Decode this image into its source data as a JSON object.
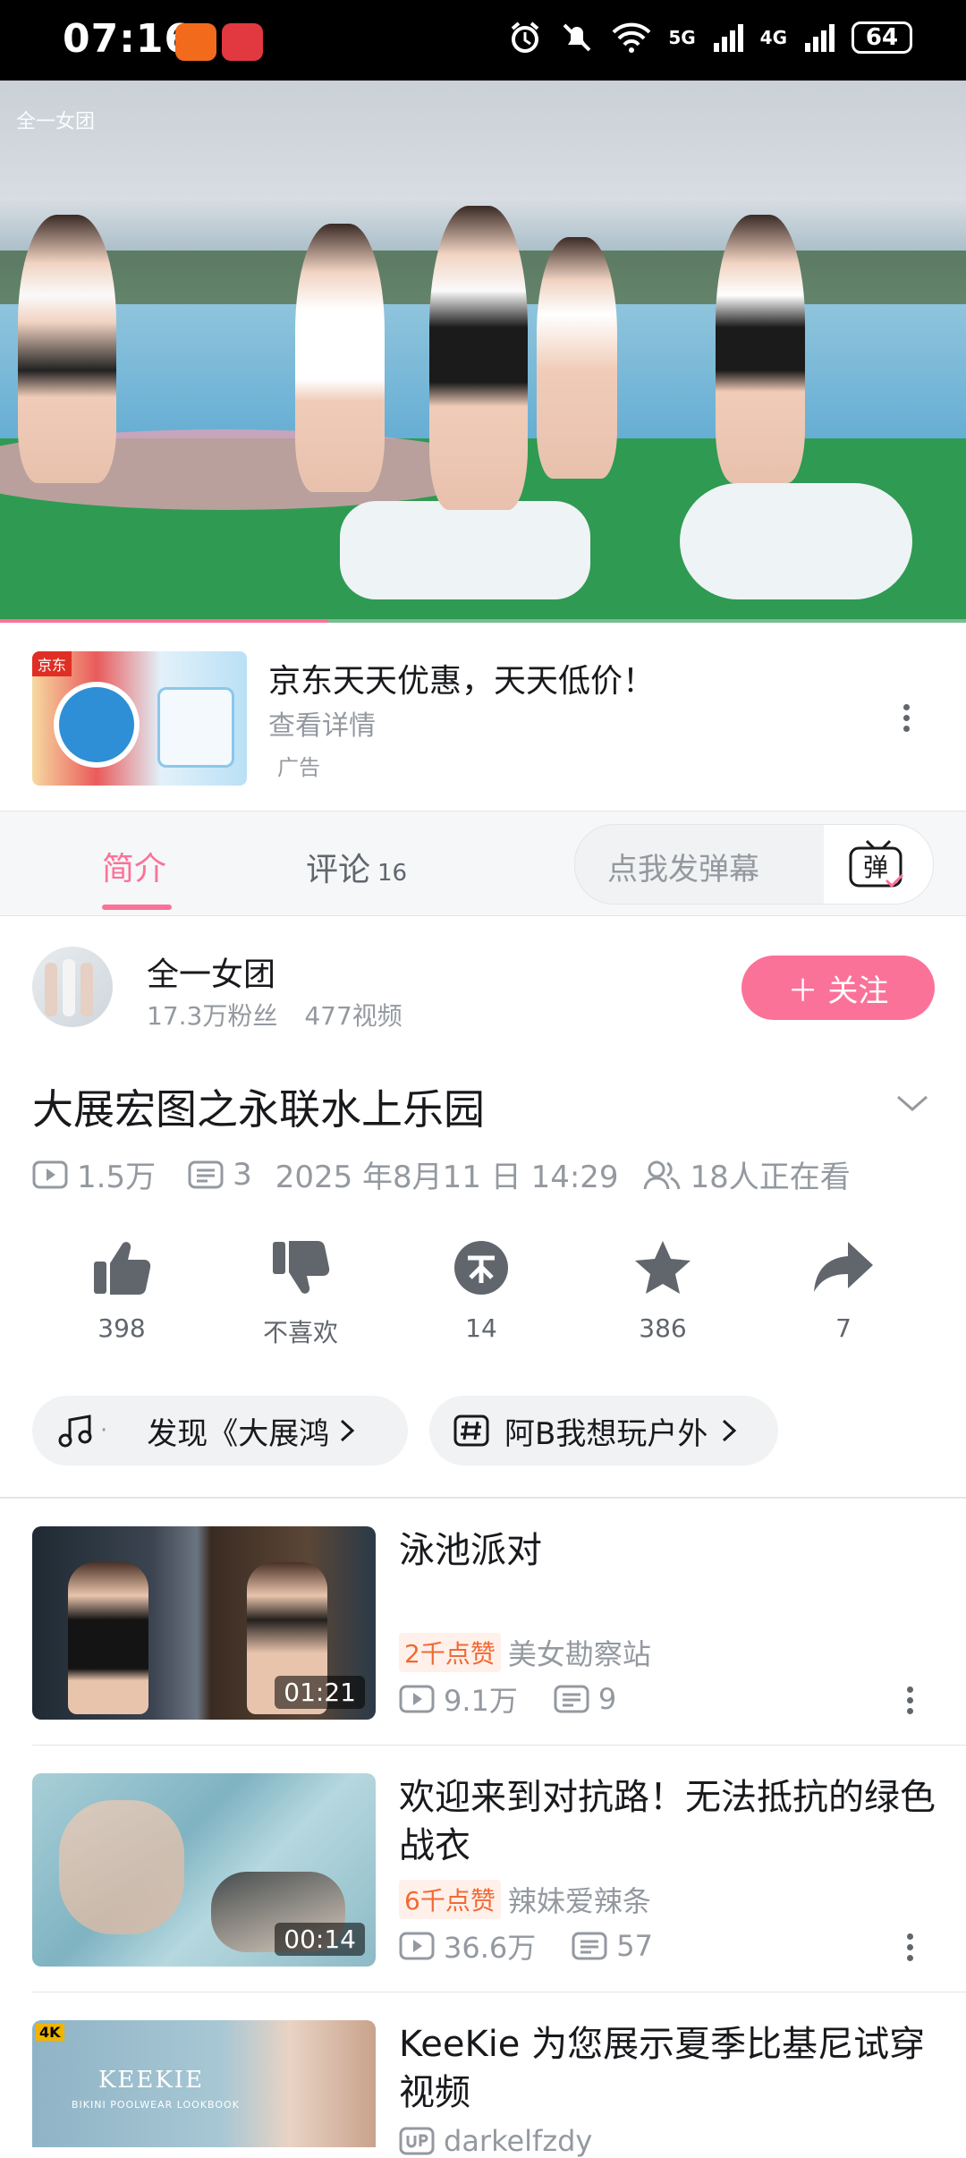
{
  "status_bar": {
    "time": "07:16",
    "network1": "5G",
    "network2": "4G",
    "battery": "64"
  },
  "video": {
    "watermark": "全一女团",
    "progress": 0.34
  },
  "ad": {
    "title": "京东天天优惠，天天低价！",
    "subtitle": "查看详情",
    "tag": "广告",
    "thumb_brand": "京东"
  },
  "tabs": {
    "intro": "简介",
    "comments": "评论",
    "comments_count": "16",
    "danmaku_placeholder": "点我发弹幕",
    "danmaku_button": "弹"
  },
  "author": {
    "name": "全一女团",
    "fans": "17.3万粉丝",
    "videos": "477视频",
    "follow_label": "＋ 关注"
  },
  "video_info": {
    "title": "大展宏图之永联水上乐园",
    "views": "1.5万",
    "danmaku": "3",
    "date": "2025 年8月11 日 14:29",
    "watching": "18人正在看"
  },
  "actions": [
    {
      "name": "like",
      "label": "398"
    },
    {
      "name": "dislike",
      "label": "不喜欢"
    },
    {
      "name": "coin",
      "label": "14"
    },
    {
      "name": "favorite",
      "label": "386"
    },
    {
      "name": "share",
      "label": "7"
    }
  ],
  "pills": {
    "music": "发现《大展鸿",
    "topic": "阿B我想玩户外"
  },
  "related": [
    {
      "title": "泳池派对",
      "likes": "2千点赞",
      "author": "美女勘察站",
      "views": "9.1万",
      "danmaku": "9",
      "duration": "01:21"
    },
    {
      "title": "欢迎来到对抗路！无法抵抗的绿色战衣",
      "likes": "6千点赞",
      "author": "辣妹爱辣条",
      "views": "36.6万",
      "danmaku": "57",
      "duration": "00:14"
    },
    {
      "title": "KeeKie 为您展示夏季比基尼试穿视频",
      "author": "darkelfzdy",
      "thumb_text": "KEEKIE",
      "thumb_sub": "BIKINI POOLWEAR LOOKBOOK",
      "badge": "4K"
    }
  ],
  "colors": {
    "accent": "#fb7299",
    "text": "#18191c",
    "muted": "#9499a0",
    "likes_badge": "#f06a34"
  }
}
